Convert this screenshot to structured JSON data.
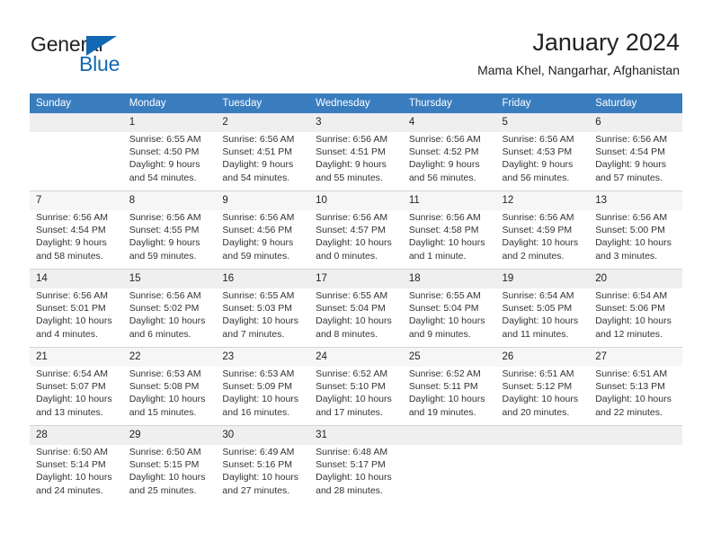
{
  "logo": {
    "word1": "General",
    "word2": "Blue",
    "accent_color": "#1268b3"
  },
  "header": {
    "month_title": "January 2024",
    "location": "Mama Khel, Nangarhar, Afghanistan"
  },
  "calendar": {
    "header_bg": "#3a7dbf",
    "weekday_headers": [
      "Sunday",
      "Monday",
      "Tuesday",
      "Wednesday",
      "Thursday",
      "Friday",
      "Saturday"
    ],
    "weeks": [
      [
        {
          "day": ""
        },
        {
          "day": "1",
          "sunrise": "Sunrise: 6:55 AM",
          "sunset": "Sunset: 4:50 PM",
          "daylight1": "Daylight: 9 hours",
          "daylight2": "and 54 minutes."
        },
        {
          "day": "2",
          "sunrise": "Sunrise: 6:56 AM",
          "sunset": "Sunset: 4:51 PM",
          "daylight1": "Daylight: 9 hours",
          "daylight2": "and 54 minutes."
        },
        {
          "day": "3",
          "sunrise": "Sunrise: 6:56 AM",
          "sunset": "Sunset: 4:51 PM",
          "daylight1": "Daylight: 9 hours",
          "daylight2": "and 55 minutes."
        },
        {
          "day": "4",
          "sunrise": "Sunrise: 6:56 AM",
          "sunset": "Sunset: 4:52 PM",
          "daylight1": "Daylight: 9 hours",
          "daylight2": "and 56 minutes."
        },
        {
          "day": "5",
          "sunrise": "Sunrise: 6:56 AM",
          "sunset": "Sunset: 4:53 PM",
          "daylight1": "Daylight: 9 hours",
          "daylight2": "and 56 minutes."
        },
        {
          "day": "6",
          "sunrise": "Sunrise: 6:56 AM",
          "sunset": "Sunset: 4:54 PM",
          "daylight1": "Daylight: 9 hours",
          "daylight2": "and 57 minutes."
        }
      ],
      [
        {
          "day": "7",
          "sunrise": "Sunrise: 6:56 AM",
          "sunset": "Sunset: 4:54 PM",
          "daylight1": "Daylight: 9 hours",
          "daylight2": "and 58 minutes."
        },
        {
          "day": "8",
          "sunrise": "Sunrise: 6:56 AM",
          "sunset": "Sunset: 4:55 PM",
          "daylight1": "Daylight: 9 hours",
          "daylight2": "and 59 minutes."
        },
        {
          "day": "9",
          "sunrise": "Sunrise: 6:56 AM",
          "sunset": "Sunset: 4:56 PM",
          "daylight1": "Daylight: 9 hours",
          "daylight2": "and 59 minutes."
        },
        {
          "day": "10",
          "sunrise": "Sunrise: 6:56 AM",
          "sunset": "Sunset: 4:57 PM",
          "daylight1": "Daylight: 10 hours",
          "daylight2": "and 0 minutes."
        },
        {
          "day": "11",
          "sunrise": "Sunrise: 6:56 AM",
          "sunset": "Sunset: 4:58 PM",
          "daylight1": "Daylight: 10 hours",
          "daylight2": "and 1 minute."
        },
        {
          "day": "12",
          "sunrise": "Sunrise: 6:56 AM",
          "sunset": "Sunset: 4:59 PM",
          "daylight1": "Daylight: 10 hours",
          "daylight2": "and 2 minutes."
        },
        {
          "day": "13",
          "sunrise": "Sunrise: 6:56 AM",
          "sunset": "Sunset: 5:00 PM",
          "daylight1": "Daylight: 10 hours",
          "daylight2": "and 3 minutes."
        }
      ],
      [
        {
          "day": "14",
          "sunrise": "Sunrise: 6:56 AM",
          "sunset": "Sunset: 5:01 PM",
          "daylight1": "Daylight: 10 hours",
          "daylight2": "and 4 minutes."
        },
        {
          "day": "15",
          "sunrise": "Sunrise: 6:56 AM",
          "sunset": "Sunset: 5:02 PM",
          "daylight1": "Daylight: 10 hours",
          "daylight2": "and 6 minutes."
        },
        {
          "day": "16",
          "sunrise": "Sunrise: 6:55 AM",
          "sunset": "Sunset: 5:03 PM",
          "daylight1": "Daylight: 10 hours",
          "daylight2": "and 7 minutes."
        },
        {
          "day": "17",
          "sunrise": "Sunrise: 6:55 AM",
          "sunset": "Sunset: 5:04 PM",
          "daylight1": "Daylight: 10 hours",
          "daylight2": "and 8 minutes."
        },
        {
          "day": "18",
          "sunrise": "Sunrise: 6:55 AM",
          "sunset": "Sunset: 5:04 PM",
          "daylight1": "Daylight: 10 hours",
          "daylight2": "and 9 minutes."
        },
        {
          "day": "19",
          "sunrise": "Sunrise: 6:54 AM",
          "sunset": "Sunset: 5:05 PM",
          "daylight1": "Daylight: 10 hours",
          "daylight2": "and 11 minutes."
        },
        {
          "day": "20",
          "sunrise": "Sunrise: 6:54 AM",
          "sunset": "Sunset: 5:06 PM",
          "daylight1": "Daylight: 10 hours",
          "daylight2": "and 12 minutes."
        }
      ],
      [
        {
          "day": "21",
          "sunrise": "Sunrise: 6:54 AM",
          "sunset": "Sunset: 5:07 PM",
          "daylight1": "Daylight: 10 hours",
          "daylight2": "and 13 minutes."
        },
        {
          "day": "22",
          "sunrise": "Sunrise: 6:53 AM",
          "sunset": "Sunset: 5:08 PM",
          "daylight1": "Daylight: 10 hours",
          "daylight2": "and 15 minutes."
        },
        {
          "day": "23",
          "sunrise": "Sunrise: 6:53 AM",
          "sunset": "Sunset: 5:09 PM",
          "daylight1": "Daylight: 10 hours",
          "daylight2": "and 16 minutes."
        },
        {
          "day": "24",
          "sunrise": "Sunrise: 6:52 AM",
          "sunset": "Sunset: 5:10 PM",
          "daylight1": "Daylight: 10 hours",
          "daylight2": "and 17 minutes."
        },
        {
          "day": "25",
          "sunrise": "Sunrise: 6:52 AM",
          "sunset": "Sunset: 5:11 PM",
          "daylight1": "Daylight: 10 hours",
          "daylight2": "and 19 minutes."
        },
        {
          "day": "26",
          "sunrise": "Sunrise: 6:51 AM",
          "sunset": "Sunset: 5:12 PM",
          "daylight1": "Daylight: 10 hours",
          "daylight2": "and 20 minutes."
        },
        {
          "day": "27",
          "sunrise": "Sunrise: 6:51 AM",
          "sunset": "Sunset: 5:13 PM",
          "daylight1": "Daylight: 10 hours",
          "daylight2": "and 22 minutes."
        }
      ],
      [
        {
          "day": "28",
          "sunrise": "Sunrise: 6:50 AM",
          "sunset": "Sunset: 5:14 PM",
          "daylight1": "Daylight: 10 hours",
          "daylight2": "and 24 minutes."
        },
        {
          "day": "29",
          "sunrise": "Sunrise: 6:50 AM",
          "sunset": "Sunset: 5:15 PM",
          "daylight1": "Daylight: 10 hours",
          "daylight2": "and 25 minutes."
        },
        {
          "day": "30",
          "sunrise": "Sunrise: 6:49 AM",
          "sunset": "Sunset: 5:16 PM",
          "daylight1": "Daylight: 10 hours",
          "daylight2": "and 27 minutes."
        },
        {
          "day": "31",
          "sunrise": "Sunrise: 6:48 AM",
          "sunset": "Sunset: 5:17 PM",
          "daylight1": "Daylight: 10 hours",
          "daylight2": "and 28 minutes."
        },
        {
          "day": ""
        },
        {
          "day": ""
        },
        {
          "day": ""
        }
      ]
    ]
  }
}
